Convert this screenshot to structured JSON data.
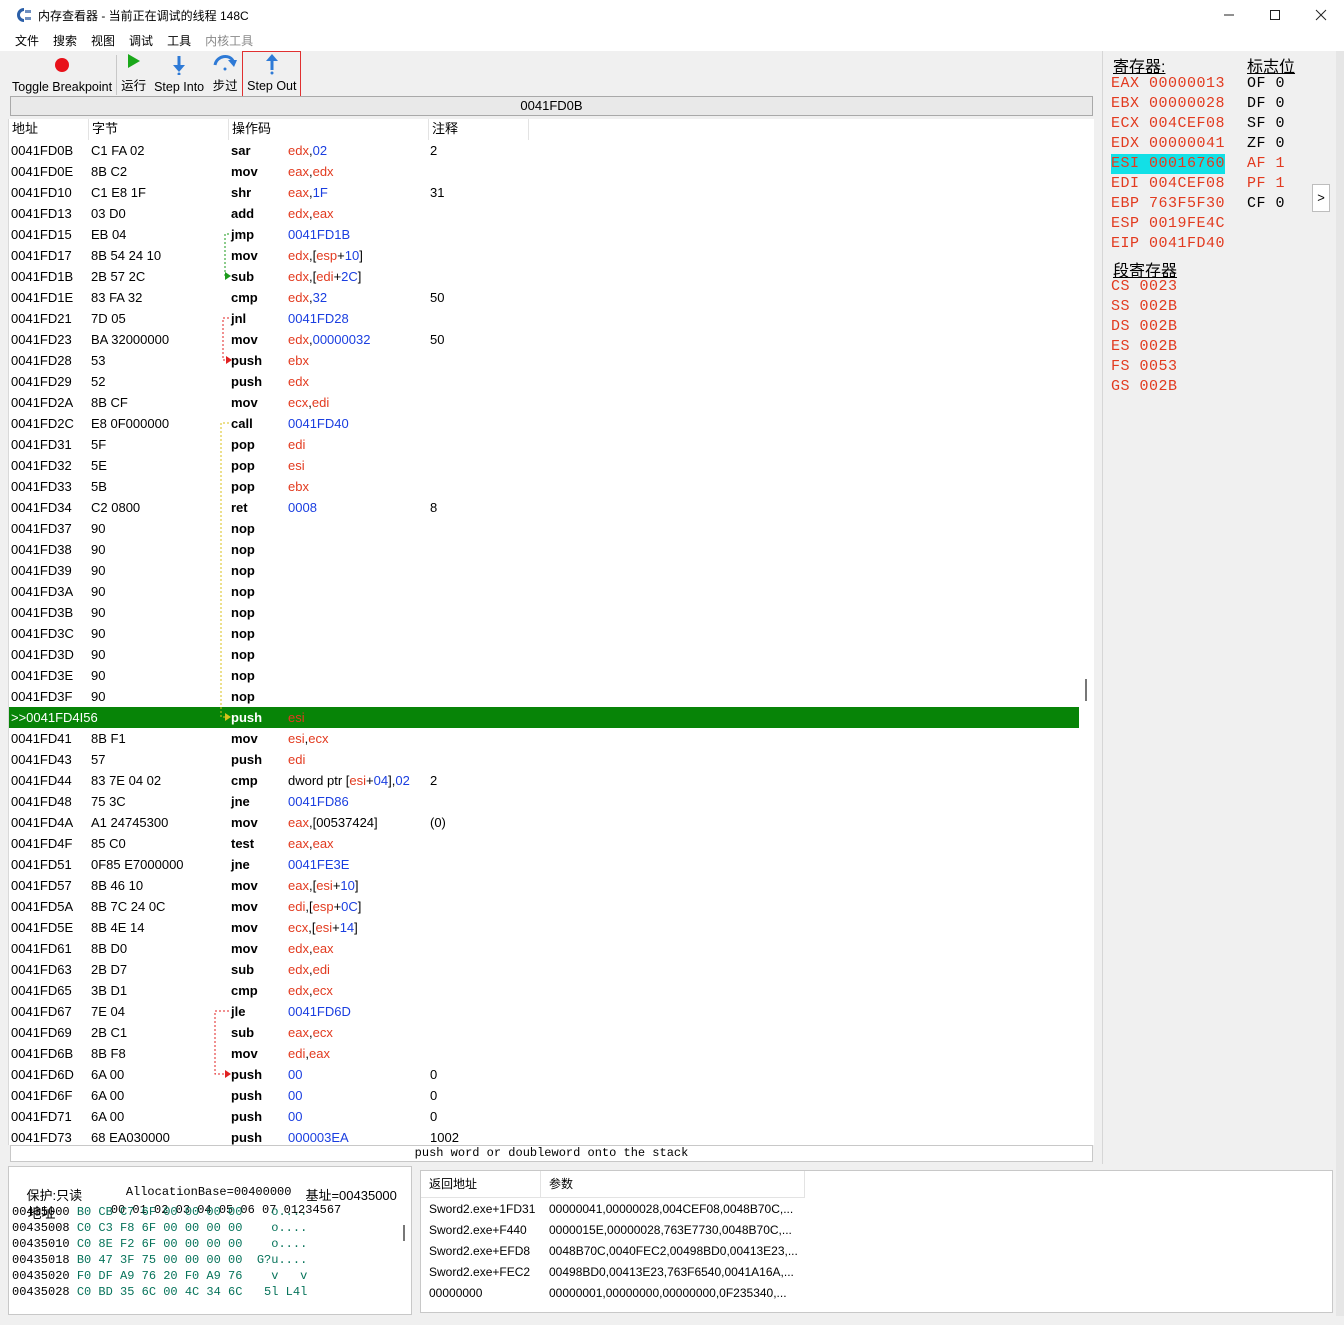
{
  "window": {
    "title": "内存查看器 - 当前正在调试的线程 148C"
  },
  "menu": [
    "文件",
    "搜索",
    "视图",
    "调试",
    "工具",
    "内核工具"
  ],
  "toolbar": {
    "toggle_breakpoint": "Toggle Breakpoint",
    "run": "运行",
    "step_into": "Step Into",
    "step_over": "步过",
    "step_out": "Step Out"
  },
  "address_bar": "0041FD0B",
  "disasm": {
    "headers": [
      "地址",
      "字节",
      "操作码",
      "注释"
    ],
    "rows": [
      {
        "addr": "0041FD0B",
        "bytes": "C1 FA 02",
        "op": "sar",
        "opr": [
          [
            "edx",
            "reg"
          ],
          [
            ",",
            ""
          ],
          [
            "02",
            "num"
          ]
        ],
        "cmt": "2"
      },
      {
        "addr": "0041FD0E",
        "bytes": "8B C2",
        "op": "mov",
        "opr": [
          [
            "eax",
            "reg"
          ],
          [
            ",",
            ""
          ],
          [
            "edx",
            "reg"
          ]
        ],
        "cmt": ""
      },
      {
        "addr": "0041FD10",
        "bytes": "C1 E8 1F",
        "op": "shr",
        "opr": [
          [
            "eax",
            "reg"
          ],
          [
            ",",
            ""
          ],
          [
            "1F",
            "num"
          ]
        ],
        "cmt": "31"
      },
      {
        "addr": "0041FD13",
        "bytes": "03 D0",
        "op": "add",
        "opr": [
          [
            "edx",
            "reg"
          ],
          [
            ",",
            ""
          ],
          [
            "eax",
            "reg"
          ]
        ],
        "cmt": ""
      },
      {
        "addr": "0041FD15",
        "bytes": "EB 04",
        "op": "jmp",
        "opr": [
          [
            "0041FD1B",
            "num"
          ]
        ],
        "cmt": ""
      },
      {
        "addr": "0041FD17",
        "bytes": "8B 54 24 10",
        "op": "mov",
        "opr": [
          [
            "edx",
            "reg"
          ],
          [
            ",[",
            ""
          ],
          [
            "esp",
            "reg"
          ],
          [
            "+",
            ""
          ],
          [
            "10",
            "num"
          ],
          [
            "]",
            ""
          ]
        ],
        "cmt": ""
      },
      {
        "addr": "0041FD1B",
        "bytes": "2B 57 2C",
        "op": "sub",
        "opr": [
          [
            "edx",
            "reg"
          ],
          [
            ",[",
            ""
          ],
          [
            "edi",
            "reg"
          ],
          [
            "+",
            ""
          ],
          [
            "2C",
            "num"
          ],
          [
            "]",
            ""
          ]
        ],
        "cmt": ""
      },
      {
        "addr": "0041FD1E",
        "bytes": "83 FA 32",
        "op": "cmp",
        "opr": [
          [
            "edx",
            "reg"
          ],
          [
            ",",
            ""
          ],
          [
            "32",
            "num"
          ]
        ],
        "cmt": "50"
      },
      {
        "addr": "0041FD21",
        "bytes": "7D 05",
        "op": "jnl",
        "opr": [
          [
            "0041FD28",
            "num"
          ]
        ],
        "cmt": ""
      },
      {
        "addr": "0041FD23",
        "bytes": "BA 32000000",
        "op": "mov",
        "opr": [
          [
            "edx",
            "reg"
          ],
          [
            ",",
            ""
          ],
          [
            "00000032",
            "num"
          ]
        ],
        "cmt": "50"
      },
      {
        "addr": "0041FD28",
        "bytes": "53",
        "op": "push",
        "opr": [
          [
            "ebx",
            "reg"
          ]
        ],
        "cmt": ""
      },
      {
        "addr": "0041FD29",
        "bytes": "52",
        "op": "push",
        "opr": [
          [
            "edx",
            "reg"
          ]
        ],
        "cmt": ""
      },
      {
        "addr": "0041FD2A",
        "bytes": "8B CF",
        "op": "mov",
        "opr": [
          [
            "ecx",
            "reg"
          ],
          [
            ",",
            ""
          ],
          [
            "edi",
            "reg"
          ]
        ],
        "cmt": ""
      },
      {
        "addr": "0041FD2C",
        "bytes": "E8 0F000000",
        "op": "call",
        "opr": [
          [
            "0041FD40",
            "num"
          ]
        ],
        "cmt": ""
      },
      {
        "addr": "0041FD31",
        "bytes": "5F",
        "op": "pop",
        "opr": [
          [
            "edi",
            "reg"
          ]
        ],
        "cmt": ""
      },
      {
        "addr": "0041FD32",
        "bytes": "5E",
        "op": "pop",
        "opr": [
          [
            "esi",
            "reg"
          ]
        ],
        "cmt": ""
      },
      {
        "addr": "0041FD33",
        "bytes": "5B",
        "op": "pop",
        "opr": [
          [
            "ebx",
            "reg"
          ]
        ],
        "cmt": ""
      },
      {
        "addr": "0041FD34",
        "bytes": "C2 0800",
        "op": "ret",
        "opr": [
          [
            "0008",
            "num"
          ]
        ],
        "cmt": "8"
      },
      {
        "addr": "0041FD37",
        "bytes": "90",
        "op": "nop",
        "opr": [],
        "cmt": ""
      },
      {
        "addr": "0041FD38",
        "bytes": "90",
        "op": "nop",
        "opr": [],
        "cmt": ""
      },
      {
        "addr": "0041FD39",
        "bytes": "90",
        "op": "nop",
        "opr": [],
        "cmt": ""
      },
      {
        "addr": "0041FD3A",
        "bytes": "90",
        "op": "nop",
        "opr": [],
        "cmt": ""
      },
      {
        "addr": "0041FD3B",
        "bytes": "90",
        "op": "nop",
        "opr": [],
        "cmt": ""
      },
      {
        "addr": "0041FD3C",
        "bytes": "90",
        "op": "nop",
        "opr": [],
        "cmt": ""
      },
      {
        "addr": "0041FD3D",
        "bytes": "90",
        "op": "nop",
        "opr": [],
        "cmt": ""
      },
      {
        "addr": "0041FD3E",
        "bytes": "90",
        "op": "nop",
        "opr": [],
        "cmt": ""
      },
      {
        "addr": "0041FD3F",
        "bytes": "90",
        "op": "nop",
        "opr": [],
        "cmt": ""
      },
      {
        "addr": ">>0041FD4I56",
        "bytes": "",
        "op": "push",
        "opr": [
          [
            "esi",
            "reg"
          ]
        ],
        "cmt": "",
        "current": true
      },
      {
        "addr": "0041FD41",
        "bytes": "8B F1",
        "op": "mov",
        "opr": [
          [
            "esi",
            "reg"
          ],
          [
            ",",
            ""
          ],
          [
            "ecx",
            "reg"
          ]
        ],
        "cmt": ""
      },
      {
        "addr": "0041FD43",
        "bytes": "57",
        "op": "push",
        "opr": [
          [
            "edi",
            "reg"
          ]
        ],
        "cmt": ""
      },
      {
        "addr": "0041FD44",
        "bytes": "83 7E 04 02",
        "op": "cmp",
        "opr": [
          [
            "dword ptr [",
            ""
          ],
          [
            "esi",
            "reg"
          ],
          [
            "+",
            ""
          ],
          [
            "04",
            "num"
          ],
          [
            "],",
            ""
          ],
          [
            "02",
            "num"
          ]
        ],
        "cmt": "2"
      },
      {
        "addr": "0041FD48",
        "bytes": "75 3C",
        "op": "jne",
        "opr": [
          [
            "0041FD86",
            "num"
          ]
        ],
        "cmt": ""
      },
      {
        "addr": "0041FD4A",
        "bytes": "A1 24745300",
        "op": "mov",
        "opr": [
          [
            "eax",
            "reg"
          ],
          [
            ",[00537424]",
            ""
          ]
        ],
        "cmt": "(0)"
      },
      {
        "addr": "0041FD4F",
        "bytes": "85 C0",
        "op": "test",
        "opr": [
          [
            "eax",
            "reg"
          ],
          [
            ",",
            ""
          ],
          [
            "eax",
            "reg"
          ]
        ],
        "cmt": ""
      },
      {
        "addr": "0041FD51",
        "bytes": "0F85 E7000000",
        "op": "jne",
        "opr": [
          [
            "0041FE3E",
            "num"
          ]
        ],
        "cmt": ""
      },
      {
        "addr": "0041FD57",
        "bytes": "8B 46 10",
        "op": "mov",
        "opr": [
          [
            "eax",
            "reg"
          ],
          [
            ",[",
            ""
          ],
          [
            "esi",
            "reg"
          ],
          [
            "+",
            ""
          ],
          [
            "10",
            "num"
          ],
          [
            "]",
            ""
          ]
        ],
        "cmt": ""
      },
      {
        "addr": "0041FD5A",
        "bytes": "8B 7C 24 0C",
        "op": "mov",
        "opr": [
          [
            "edi",
            "reg"
          ],
          [
            ",[",
            ""
          ],
          [
            "esp",
            "reg"
          ],
          [
            "+",
            ""
          ],
          [
            "0C",
            "num"
          ],
          [
            "]",
            ""
          ]
        ],
        "cmt": ""
      },
      {
        "addr": "0041FD5E",
        "bytes": "8B 4E 14",
        "op": "mov",
        "opr": [
          [
            "ecx",
            "reg"
          ],
          [
            ",[",
            ""
          ],
          [
            "esi",
            "reg"
          ],
          [
            "+",
            ""
          ],
          [
            "14",
            "num"
          ],
          [
            "]",
            ""
          ]
        ],
        "cmt": ""
      },
      {
        "addr": "0041FD61",
        "bytes": "8B D0",
        "op": "mov",
        "opr": [
          [
            "edx",
            "reg"
          ],
          [
            ",",
            ""
          ],
          [
            "eax",
            "reg"
          ]
        ],
        "cmt": ""
      },
      {
        "addr": "0041FD63",
        "bytes": "2B D7",
        "op": "sub",
        "opr": [
          [
            "edx",
            "reg"
          ],
          [
            ",",
            ""
          ],
          [
            "edi",
            "reg"
          ]
        ],
        "cmt": ""
      },
      {
        "addr": "0041FD65",
        "bytes": "3B D1",
        "op": "cmp",
        "opr": [
          [
            "edx",
            "reg"
          ],
          [
            ",",
            ""
          ],
          [
            "ecx",
            "reg"
          ]
        ],
        "cmt": ""
      },
      {
        "addr": "0041FD67",
        "bytes": "7E 04",
        "op": "jle",
        "opr": [
          [
            "0041FD6D",
            "num"
          ]
        ],
        "cmt": ""
      },
      {
        "addr": "0041FD69",
        "bytes": "2B C1",
        "op": "sub",
        "opr": [
          [
            "eax",
            "reg"
          ],
          [
            ",",
            ""
          ],
          [
            "ecx",
            "reg"
          ]
        ],
        "cmt": ""
      },
      {
        "addr": "0041FD6B",
        "bytes": "8B F8",
        "op": "mov",
        "opr": [
          [
            "edi",
            "reg"
          ],
          [
            ",",
            ""
          ],
          [
            "eax",
            "reg"
          ]
        ],
        "cmt": ""
      },
      {
        "addr": "0041FD6D",
        "bytes": "6A 00",
        "op": "push",
        "opr": [
          [
            "00",
            "num"
          ]
        ],
        "cmt": "0"
      },
      {
        "addr": "0041FD6F",
        "bytes": "6A 00",
        "op": "push",
        "opr": [
          [
            "00",
            "num"
          ]
        ],
        "cmt": "0"
      },
      {
        "addr": "0041FD71",
        "bytes": "6A 00",
        "op": "push",
        "opr": [
          [
            "00",
            "num"
          ]
        ],
        "cmt": "0"
      },
      {
        "addr": "0041FD73",
        "bytes": "68 EA030000",
        "op": "push",
        "opr": [
          [
            "000003EA",
            "num"
          ]
        ],
        "cmt": "1002"
      }
    ]
  },
  "hint": "push word or doubleword onto the stack",
  "registers": {
    "title": "寄存器:",
    "general": [
      {
        "name": "EAX",
        "value": "00000013"
      },
      {
        "name": "EBX",
        "value": "00000028"
      },
      {
        "name": "ECX",
        "value": "004CEF08"
      },
      {
        "name": "EDX",
        "value": "00000041"
      },
      {
        "name": "ESI",
        "value": "00016760",
        "highlight": true
      },
      {
        "name": "EDI",
        "value": "004CEF08"
      },
      {
        "name": "EBP",
        "value": "763F5F30"
      },
      {
        "name": "ESP",
        "value": "0019FE4C"
      },
      {
        "name": "EIP",
        "value": "0041FD40"
      }
    ],
    "segment_title": "段寄存器",
    "segment": [
      {
        "name": "CS",
        "value": "0023"
      },
      {
        "name": "SS",
        "value": "002B"
      },
      {
        "name": "DS",
        "value": "002B"
      },
      {
        "name": "ES",
        "value": "002B"
      },
      {
        "name": "FS",
        "value": "0053"
      },
      {
        "name": "GS",
        "value": "002B"
      }
    ],
    "flags_title": "标志位",
    "flags": [
      {
        "name": "OF",
        "value": "0"
      },
      {
        "name": "DF",
        "value": "0"
      },
      {
        "name": "SF",
        "value": "0"
      },
      {
        "name": "ZF",
        "value": "0"
      },
      {
        "name": "AF",
        "value": "1",
        "changed": true
      },
      {
        "name": "PF",
        "value": "1",
        "changed": true
      },
      {
        "name": "CF",
        "value": "0"
      }
    ],
    "expand": ">"
  },
  "hex": {
    "info_protect": "保护:只读",
    "info_alloc": "AllocationBase=00400000",
    "info_base": "基址=00435000",
    "header_label": "地址",
    "header_cols": "00 01 02 03 04 05 06 07 01234567",
    "rows": [
      {
        "addr": "00435000",
        "bytes": "B0 CB C7 6F 00 00 00 00",
        "ascii": "   o...."
      },
      {
        "addr": "00435008",
        "bytes": "C0 C3 F8 6F 00 00 00 00",
        "ascii": "   o...."
      },
      {
        "addr": "00435010",
        "bytes": "C0 8E F2 6F 00 00 00 00",
        "ascii": "   o...."
      },
      {
        "addr": "00435018",
        "bytes": "B0 47 3F 75 00 00 00 00",
        "ascii": " G?u...."
      },
      {
        "addr": "00435020",
        "bytes": "F0 DF A9 76 20 F0 A9 76",
        "ascii": "   v   v"
      },
      {
        "addr": "00435028",
        "bytes": "C0 BD 35 6C 00 4C 34 6C",
        "ascii": "  5l L4l"
      }
    ]
  },
  "stack": {
    "headers": [
      "返回地址",
      "参数"
    ],
    "rows": [
      {
        "ret": "Sword2.exe+1FD31",
        "params": "00000041,00000028,004CEF08,0048B70C,..."
      },
      {
        "ret": "Sword2.exe+F440",
        "params": "0000015E,00000028,763E7730,0048B70C,..."
      },
      {
        "ret": "Sword2.exe+EFD8",
        "params": "0048B70C,0040FEC2,00498BD0,00413E23,..."
      },
      {
        "ret": "Sword2.exe+FEC2",
        "params": "00498BD0,00413E23,763F6540,0041A16A,..."
      },
      {
        "ret": "00000000",
        "params": "00000001,00000000,00000000,0F235340,..."
      }
    ]
  },
  "colors": {
    "register": "#e23a1f",
    "immediate": "#1a3ee0",
    "current_line": "#078407",
    "esi_highlight": "#12e0e6",
    "hex_data": "#06735a"
  }
}
